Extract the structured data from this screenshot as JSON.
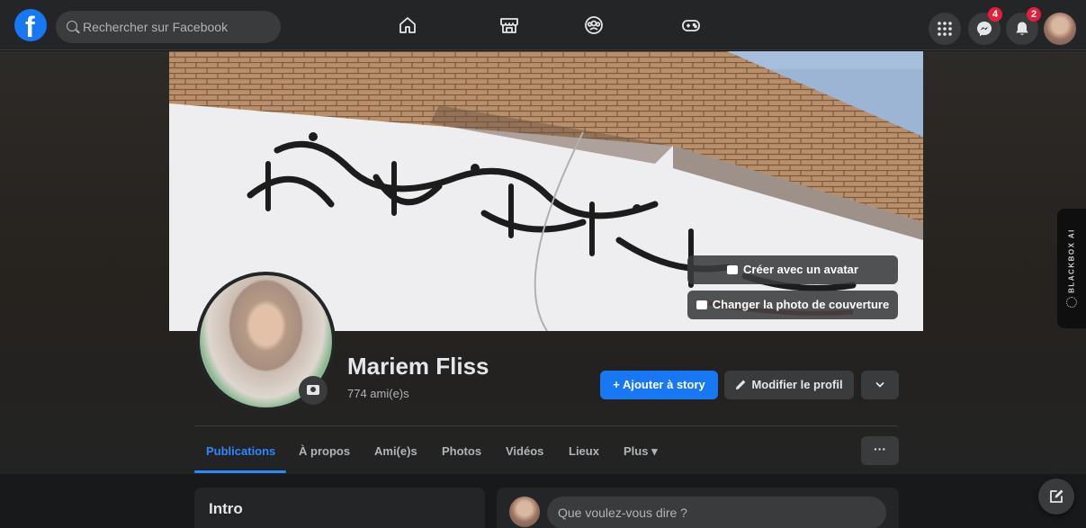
{
  "topbar": {
    "logo_letter": "f",
    "search_placeholder": "Rechercher sur Facebook",
    "nav_icons": [
      "home-icon",
      "marketplace-icon",
      "groups-icon",
      "gaming-icon"
    ],
    "messenger_badge": "4",
    "notifications_badge": "2"
  },
  "cover": {
    "create_avatar_label": "Créer avec un avatar",
    "change_cover_label": "Changer la photo de couverture"
  },
  "profile": {
    "name": "Mariem Fliss",
    "friends": "774 ami(e)s",
    "add_story_label": "+ Ajouter à story",
    "edit_profile_label": "Modifier le profil"
  },
  "tabs": [
    {
      "label": "Publications",
      "active": true
    },
    {
      "label": "À propos"
    },
    {
      "label": "Ami(e)s"
    },
    {
      "label": "Photos"
    },
    {
      "label": "Vidéos"
    },
    {
      "label": "Lieux"
    },
    {
      "label": "Plus ▾"
    }
  ],
  "more_label": "···",
  "intro": {
    "title": "Intro"
  },
  "composer": {
    "placeholder": "Que voulez-vous dire ?"
  },
  "blackbox": {
    "label": "BLACKBOX AI"
  },
  "colors": {
    "accent": "#1877f2",
    "badge": "#e41e3f",
    "surface": "#242526",
    "background": "#18191a"
  }
}
